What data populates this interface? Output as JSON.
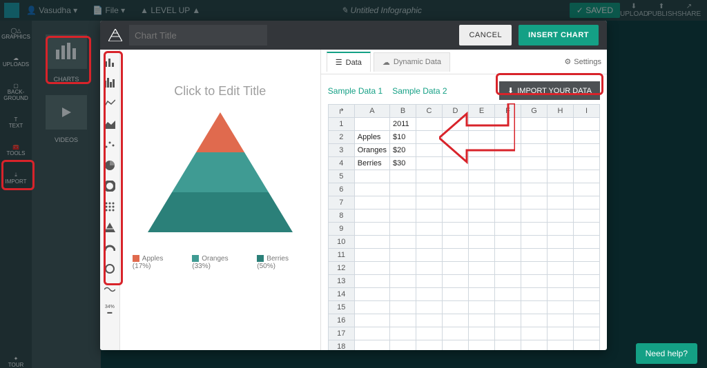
{
  "topbar": {
    "user": "Vasudha",
    "file_menu": "File",
    "levelup": "LEVEL UP",
    "doc_title": "Untitled Infographic",
    "saved_badge": "SAVED",
    "right": [
      "UPLOAD",
      "PUBLISH",
      "SHARE"
    ]
  },
  "leftnav": [
    {
      "label": "GRAPHICS",
      "icon": "shapes"
    },
    {
      "label": "UPLOADS",
      "icon": "upload"
    },
    {
      "label": "BACK-GROUND",
      "icon": "square"
    },
    {
      "label": "TEXT",
      "icon": "text"
    },
    {
      "label": "TOOLS",
      "icon": "tool"
    },
    {
      "label": "IMPORT",
      "icon": "import"
    }
  ],
  "secondary": [
    {
      "label": "CHARTS"
    },
    {
      "label": "VIDEOS"
    }
  ],
  "modal": {
    "title_placeholder": "Chart Title",
    "cancel": "CANCEL",
    "insert": "INSERT CHART"
  },
  "chart_types": [
    "bar",
    "column",
    "line",
    "area",
    "scatter",
    "pie",
    "donut",
    "grid",
    "pyramid",
    "gauge",
    "ring",
    "spark",
    "pct"
  ],
  "preview": {
    "title": "Click to Edit Title"
  },
  "data_tabs": {
    "data": "Data",
    "dynamic": "Dynamic Data",
    "settings": "Settings"
  },
  "data_toolbar": {
    "sample1": "Sample Data 1",
    "sample2": "Sample Data 2",
    "import": "IMPORT YOUR DATA"
  },
  "sheet": {
    "cols": [
      "A",
      "B",
      "C",
      "D",
      "E",
      "F",
      "G",
      "H",
      "I"
    ],
    "rows": [
      {
        "A": "",
        "B": "2011"
      },
      {
        "A": "Apples",
        "B": "$10"
      },
      {
        "A": "Oranges",
        "B": "$20"
      },
      {
        "A": "Berries",
        "B": "$30"
      }
    ],
    "blank_rows": 15
  },
  "chart_data": {
    "type": "pyramid",
    "title": "Click to Edit Title",
    "categories": [
      "Apples",
      "Oranges",
      "Berries"
    ],
    "values": [
      10,
      20,
      30
    ],
    "percent": [
      17,
      33,
      50
    ],
    "colors": {
      "Apples": "#e06a4e",
      "Oranges": "#3f9b93",
      "Berries": "#2b8079"
    },
    "legend_labels": [
      "Apples (17%)",
      "Oranges (33%)",
      "Berries (50%)"
    ],
    "year_header": "2011"
  },
  "need_help": "Need help?",
  "leftnav_tour": "TOUR"
}
